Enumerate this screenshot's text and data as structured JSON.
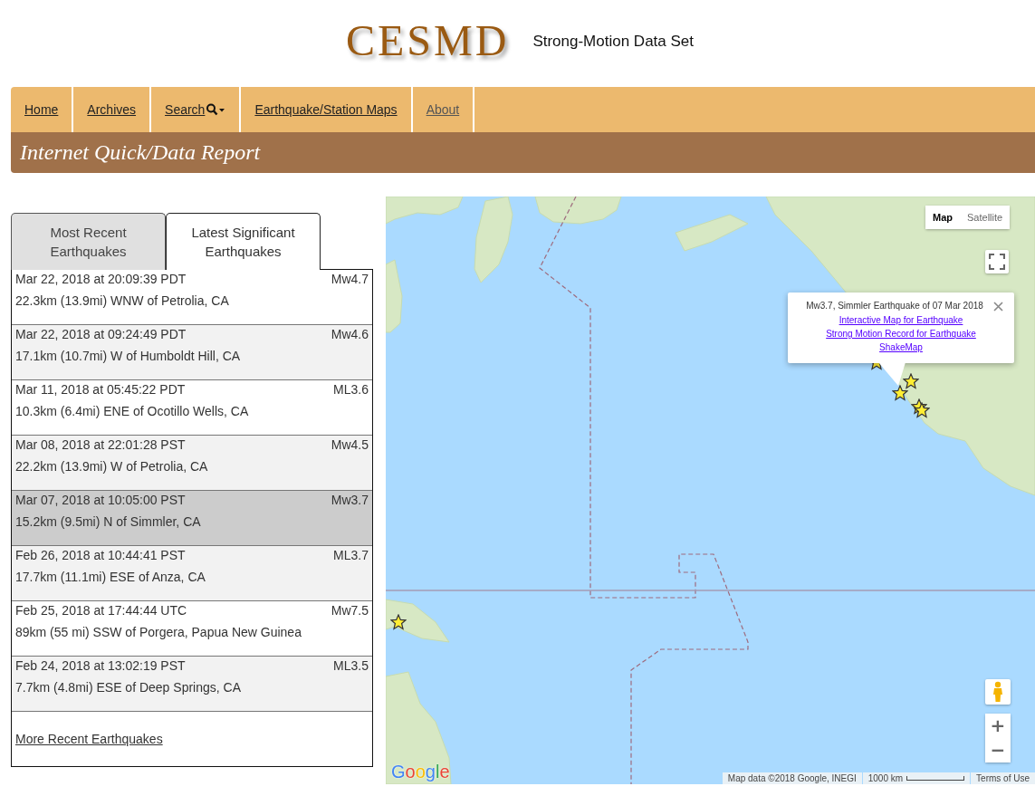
{
  "header": {
    "logo": "CESMD",
    "tagline": "Strong-Motion Data Set"
  },
  "nav": [
    {
      "label": "Home",
      "kind": "link",
      "dimmed": false
    },
    {
      "label": "Archives",
      "kind": "link",
      "dimmed": false
    },
    {
      "label": "Search",
      "kind": "dropdown",
      "dimmed": false
    },
    {
      "label": "Earthquake/Station Maps",
      "kind": "link",
      "dimmed": false
    },
    {
      "label": "About",
      "kind": "link",
      "dimmed": true
    }
  ],
  "banner": {
    "title": "Internet Quick/Data Report"
  },
  "tabs": [
    {
      "label": "Most Recent Earthquakes",
      "selected": false
    },
    {
      "label": "Latest Significant Earthquakes",
      "selected": true
    }
  ],
  "earthquakes": [
    {
      "time": "Mar 22, 2018 at 20:09:39 PDT",
      "magnitude": "Mw4.7",
      "location": "22.3km (13.9mi) WNW of Petrolia, CA",
      "selected": false
    },
    {
      "time": "Mar 22, 2018 at 09:24:49 PDT",
      "magnitude": "Mw4.6",
      "location": "17.1km (10.7mi) W of Humboldt Hill, CA",
      "selected": false
    },
    {
      "time": "Mar 11, 2018 at 05:45:22 PDT",
      "magnitude": "ML3.6",
      "location": "10.3km (6.4mi) ENE of Ocotillo Wells, CA",
      "selected": false
    },
    {
      "time": "Mar 08, 2018 at 22:01:28 PST",
      "magnitude": "Mw4.5",
      "location": "22.2km (13.9mi) W of Petrolia, CA",
      "selected": false
    },
    {
      "time": "Mar 07, 2018 at 10:05:00 PST",
      "magnitude": "Mw3.7",
      "location": "15.2km (9.5mi) N of Simmler, CA",
      "selected": true
    },
    {
      "time": "Feb 26, 2018 at 10:44:41 PST",
      "magnitude": "ML3.7",
      "location": "17.7km (11.1mi) ESE of Anza, CA",
      "selected": false
    },
    {
      "time": "Feb 25, 2018 at 17:44:44 UTC",
      "magnitude": "Mw7.5",
      "location": "89km (55 mi) SSW of Porgera, Papua New Guinea",
      "selected": false
    },
    {
      "time": "Feb 24, 2018 at 13:02:19 PST",
      "magnitude": "ML3.5",
      "location": "7.7km (4.8mi) ESE of Deep Springs, CA",
      "selected": false
    }
  ],
  "more_link": "More Recent Earthquakes",
  "map": {
    "map_types": [
      {
        "label": "Map",
        "selected": true
      },
      {
        "label": "Satellite",
        "selected": false
      }
    ],
    "popup": {
      "title": "Mw3.7, Simmler Earthquake of 07 Mar 2018",
      "links": [
        "Interactive Map for Earthquake",
        "Strong Motion Record for Earthquake",
        "ShakeMap"
      ]
    },
    "zoom_in": "+",
    "zoom_out": "−",
    "logo": "Google",
    "attribution": "Map data ©2018 Google, INEGI",
    "scale": "1000 km",
    "terms": "Terms of Use"
  }
}
